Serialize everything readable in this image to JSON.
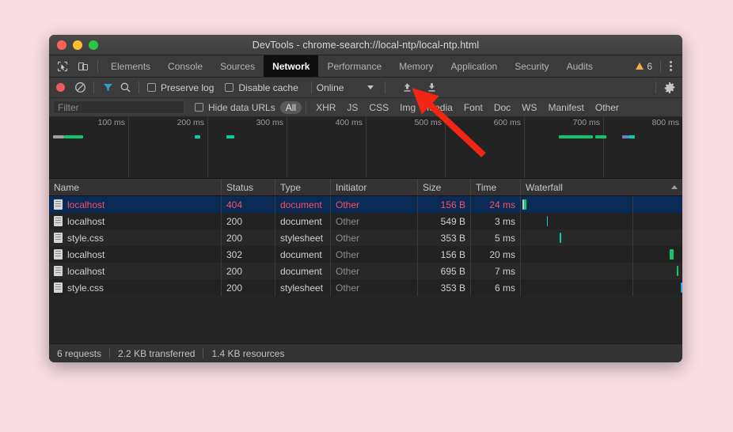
{
  "window": {
    "title": "DevTools - chrome-search://local-ntp/local-ntp.html",
    "traffic_lights": [
      "close",
      "minimize",
      "maximize"
    ]
  },
  "tabs": {
    "items": [
      {
        "label": "Elements",
        "active": false
      },
      {
        "label": "Console",
        "active": false
      },
      {
        "label": "Sources",
        "active": false
      },
      {
        "label": "Network",
        "active": true
      },
      {
        "label": "Performance",
        "active": false
      },
      {
        "label": "Memory",
        "active": false
      },
      {
        "label": "Application",
        "active": false
      },
      {
        "label": "Security",
        "active": false
      },
      {
        "label": "Audits",
        "active": false
      }
    ],
    "warning_count": "6"
  },
  "toolbar": {
    "preserve_log_label": "Preserve log",
    "preserve_log_checked": false,
    "disable_cache_label": "Disable cache",
    "disable_cache_checked": false,
    "throttling_value": "Online"
  },
  "filterbar": {
    "filter_placeholder": "Filter",
    "filter_value": "",
    "hide_data_urls_label": "Hide data URLs",
    "hide_data_urls_checked": false,
    "types": [
      {
        "label": "All",
        "selected": true
      },
      {
        "label": "XHR",
        "selected": false
      },
      {
        "label": "JS",
        "selected": false
      },
      {
        "label": "CSS",
        "selected": false
      },
      {
        "label": "Img",
        "selected": false
      },
      {
        "label": "Media",
        "selected": false
      },
      {
        "label": "Font",
        "selected": false
      },
      {
        "label": "Doc",
        "selected": false
      },
      {
        "label": "WS",
        "selected": false
      },
      {
        "label": "Manifest",
        "selected": false
      },
      {
        "label": "Other",
        "selected": false
      }
    ]
  },
  "overview": {
    "tick_labels": [
      "100 ms",
      "200 ms",
      "300 ms",
      "400 ms",
      "500 ms",
      "600 ms",
      "700 ms",
      "800 ms"
    ],
    "bars": [
      {
        "left_pct": 0.6,
        "width_pct": 1.8,
        "color": "#9aa0a6"
      },
      {
        "left_pct": 2.4,
        "width_pct": 3.0,
        "color": "#12c46a"
      },
      {
        "left_pct": 23.0,
        "width_pct": 0.9,
        "color": "#00d0b0"
      },
      {
        "left_pct": 28.0,
        "width_pct": 1.3,
        "color": "#00d0b0"
      },
      {
        "left_pct": 80.5,
        "width_pct": 5.4,
        "color": "#12c46a"
      },
      {
        "left_pct": 86.2,
        "width_pct": 1.8,
        "color": "#12c46a"
      },
      {
        "left_pct": 90.5,
        "width_pct": 1.0,
        "color": "#6b7fd7"
      },
      {
        "left_pct": 91.5,
        "width_pct": 1.0,
        "color": "#00d0b0"
      }
    ]
  },
  "table": {
    "columns": [
      "Name",
      "Status",
      "Type",
      "Initiator",
      "Size",
      "Time",
      "Waterfall"
    ],
    "sorted_column": "Waterfall",
    "rows": [
      {
        "name": "localhost",
        "status": "404",
        "type": "document",
        "initiator": "Other",
        "size": "156 B",
        "time": "24 ms",
        "error": true,
        "selected": true,
        "bar_left_pct": 1.0,
        "bar_width_pct": 1.2,
        "bar_color": "#12c46a",
        "bar_lead_pct": 1.0,
        "bar_lead_color": "#c8c8c8"
      },
      {
        "name": "localhost",
        "status": "200",
        "type": "document",
        "initiator": "Other",
        "size": "549 B",
        "time": "3 ms",
        "error": false,
        "selected": false,
        "bar_left_pct": 16.0,
        "bar_width_pct": 0.8,
        "bar_color": "#00d0b0",
        "bar_lead_pct": 0,
        "bar_lead_color": ""
      },
      {
        "name": "style.css",
        "status": "200",
        "type": "stylesheet",
        "initiator": "Other",
        "size": "353 B",
        "time": "5 ms",
        "error": false,
        "selected": false,
        "bar_left_pct": 24.0,
        "bar_width_pct": 0.8,
        "bar_color": "#00d0b0",
        "bar_lead_pct": 0,
        "bar_lead_color": ""
      },
      {
        "name": "localhost",
        "status": "302",
        "type": "document",
        "initiator": "Other",
        "size": "156 B",
        "time": "20 ms",
        "error": false,
        "selected": false,
        "bar_left_pct": 92.0,
        "bar_width_pct": 2.4,
        "bar_color": "#12c46a",
        "bar_lead_pct": 0,
        "bar_lead_color": ""
      },
      {
        "name": "localhost",
        "status": "200",
        "type": "document",
        "initiator": "Other",
        "size": "695 B",
        "time": "7 ms",
        "error": false,
        "selected": false,
        "bar_left_pct": 96.5,
        "bar_width_pct": 0.9,
        "bar_color": "#12c46a",
        "bar_lead_pct": 0,
        "bar_lead_color": ""
      },
      {
        "name": "style.css",
        "status": "200",
        "type": "stylesheet",
        "initiator": "Other",
        "size": "353 B",
        "time": "6 ms",
        "error": false,
        "selected": false,
        "bar_left_pct": 99.0,
        "bar_width_pct": 0.9,
        "bar_color": "#2da7f2",
        "bar_lead_pct": 0,
        "bar_lead_color": ""
      }
    ]
  },
  "statusbar": {
    "requests": "6 requests",
    "transferred": "2.2 KB transferred",
    "resources": "1.4 KB resources"
  },
  "annotation": {
    "arrow_color": "#f22613"
  },
  "colors": {
    "page_background": "#f9dde3",
    "error": "#ff4d5e",
    "accent_blue": "#0a2b56",
    "record": "#ec5b5b"
  }
}
